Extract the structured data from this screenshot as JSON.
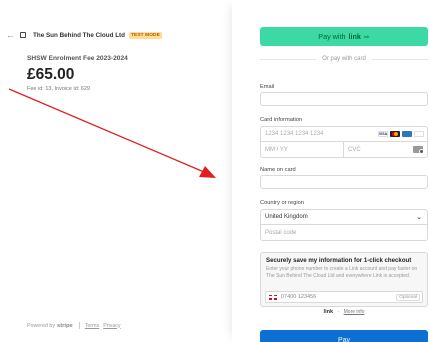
{
  "header": {
    "merchant": "The Sun Behind The Cloud Ltd",
    "test_badge": "TEST MODE"
  },
  "summary": {
    "product": "SHSW Enrolment Fee 2023-2024",
    "amount": "£65.00",
    "ids": "Fee id: 13, Invoice id: 629"
  },
  "footer": {
    "powered": "Powered by",
    "brand": "stripe",
    "terms": "Terms",
    "privacy": "Privacy"
  },
  "pay_with_link": {
    "label": "Pay with",
    "brand": "link",
    "arrow": "⇨"
  },
  "or_text": "Or pay with card",
  "email": {
    "label": "Email",
    "value": ""
  },
  "card": {
    "label": "Card information",
    "number_placeholder": "1234 1234 1234 1234",
    "expiry_placeholder": "MM / YY",
    "cvc_placeholder": "CVC",
    "brands": [
      "VISA",
      "mastercard",
      "AMEX",
      "discover"
    ]
  },
  "name": {
    "label": "Name on card",
    "value": ""
  },
  "country": {
    "label": "Country or region",
    "selected": "United Kingdom",
    "postal_placeholder": "Postal code"
  },
  "save": {
    "title": "Securely save my information for 1-click checkout",
    "desc": "Enter your phone number to create a Link account and pay faster on The Sun Behind The Cloud Ltd and everywhere Link is accepted.",
    "phone_placeholder": "07400 123456",
    "optional": "Optional"
  },
  "link_row": {
    "brand": "link",
    "sep": "·",
    "more": "More info"
  },
  "pay_button": "Pay",
  "colors": {
    "link_green": "#3dd9a5",
    "pay_blue": "#0b6fd4",
    "arrow_red": "#e02020",
    "test_badge": "#ffde92"
  }
}
